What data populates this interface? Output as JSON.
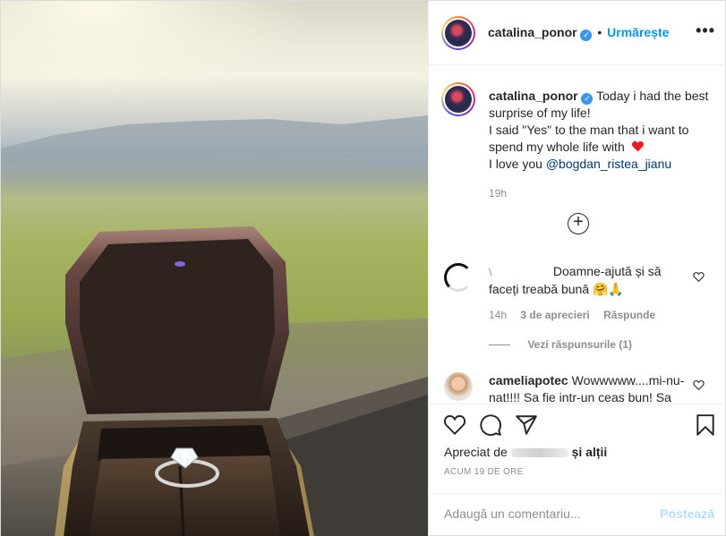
{
  "post": {
    "author": "catalina_ponor",
    "follow_label": "Urmărește",
    "more_icon": "more-dots-icon",
    "caption": {
      "line1": "Today i had the best",
      "line2": "surprise of my life!",
      "line3": "I said \"Yes\" to the man that i want to",
      "line4": "spend my whole life with",
      "line5_prefix": "I love you",
      "mention": "@bogdan_ristea_jianu"
    },
    "caption_time": "19h"
  },
  "comments": [
    {
      "username": "\\",
      "text_line1": "Doamne-ajută și să",
      "text_line2": "faceți treabă bună 🤗🙏",
      "time": "14h",
      "likes": "3 de aprecieri",
      "reply": "Răspunde",
      "view_replies": "Vezi răspunsurile (1)"
    },
    {
      "username": "cameliapotec",
      "text_line1": "Wowwwww....mi-nu-",
      "text_line2": "nat!!!! Sa fie intr-un ceas bun! Sa"
    }
  ],
  "actions": {
    "liked_prefix": "Apreciat de",
    "liked_suffix": "și alții",
    "timestamp": "ACUM 19 DE ORE"
  },
  "comment_input": {
    "placeholder": "Adaugă un comentariu...",
    "post_label": "Postează"
  },
  "colors": {
    "link_blue": "#0095f6",
    "heart_red": "#ed4956",
    "post_disabled": "#b2dffc"
  }
}
